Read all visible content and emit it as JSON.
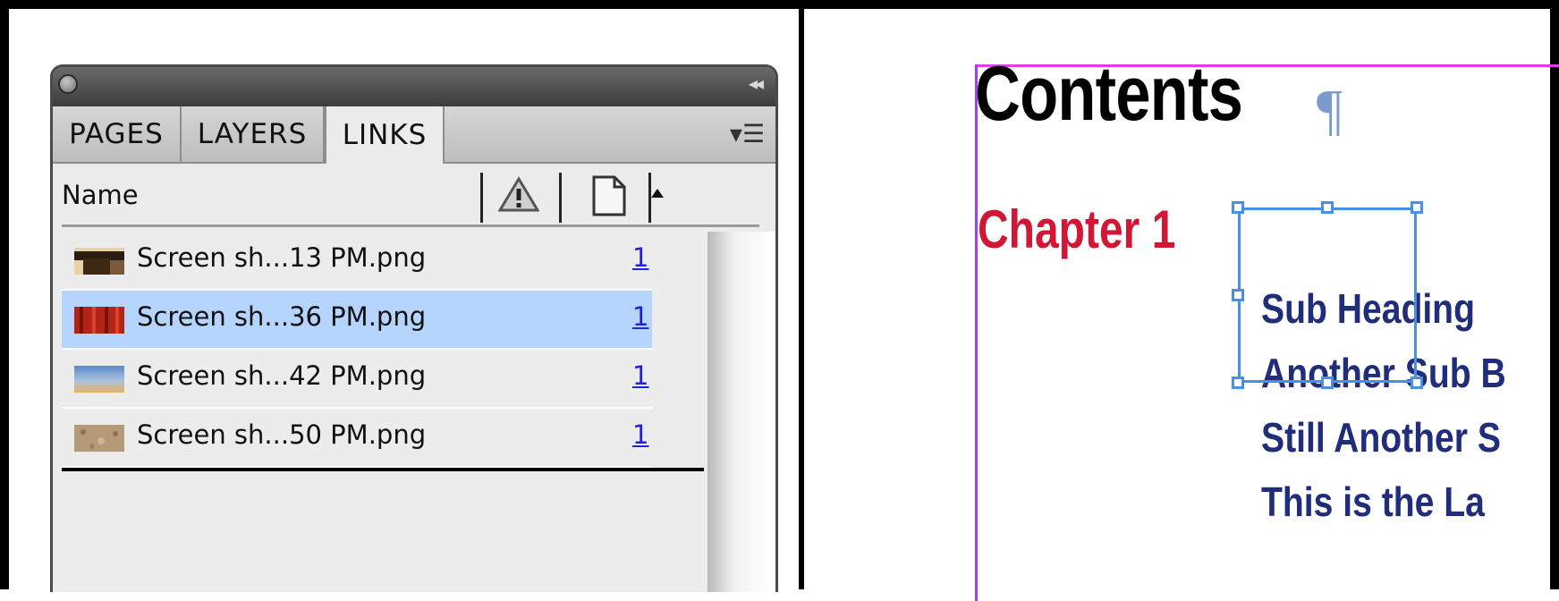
{
  "links_panel": {
    "tabs": [
      {
        "label": "PAGES"
      },
      {
        "label": "LAYERS"
      },
      {
        "label": "LINKS",
        "active": true
      }
    ],
    "column_header": "Name",
    "links": [
      {
        "name": "Screen sh...13 PM.png",
        "page": "1",
        "selected": false
      },
      {
        "name": "Screen sh...36 PM.png",
        "page": "1",
        "selected": true
      },
      {
        "name": "Screen sh...42 PM.png",
        "page": "1",
        "selected": false
      },
      {
        "name": "Screen sh...50 PM.png",
        "page": "1",
        "selected": false
      }
    ],
    "colors": {
      "selection": "#b5d5fe",
      "page_link": "#2222dd"
    }
  },
  "document": {
    "title": "Contents",
    "pilcrow": "¶",
    "chapter": "Chapter 1",
    "subheadings": [
      "Sub Heading",
      "Another Sub B",
      "Still Another S",
      "This is the La"
    ],
    "colors": {
      "chapter": "#d21736",
      "subheading": "#1f2d7a",
      "frame": "#4a90e2",
      "margin": "#e03ee0"
    }
  }
}
